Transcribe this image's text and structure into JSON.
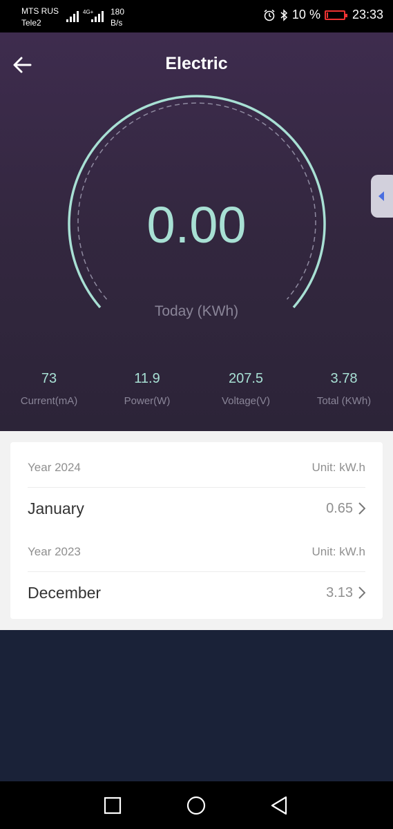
{
  "status_bar": {
    "carrier1": "MTS RUS",
    "carrier2": "Tele2",
    "network_type": "4G+",
    "speed_value": "180",
    "speed_unit": "B/s",
    "battery": "10 %",
    "time": "23:33",
    "battery_color": "#e33333"
  },
  "header": {
    "title": "Electric",
    "back_icon": "arrow-left-icon"
  },
  "gauge": {
    "value": "0.00",
    "label": "Today (KWh)",
    "accent_color": "#a8e0d4"
  },
  "stats": [
    {
      "value": "73",
      "label": "Current(mA)"
    },
    {
      "value": "11.9",
      "label": "Power(W)"
    },
    {
      "value": "207.5",
      "label": "Voltage(V)"
    },
    {
      "value": "3.78",
      "label": "Total (KWh)"
    }
  ],
  "history": [
    {
      "year": "Year 2024",
      "unit": "Unit: kW.h",
      "month": "January",
      "value": "0.65"
    },
    {
      "year": "Year 2023",
      "unit": "Unit: kW.h",
      "month": "December",
      "value": "3.13"
    }
  ],
  "nav": [
    "recent-apps-icon",
    "home-icon",
    "back-icon"
  ]
}
